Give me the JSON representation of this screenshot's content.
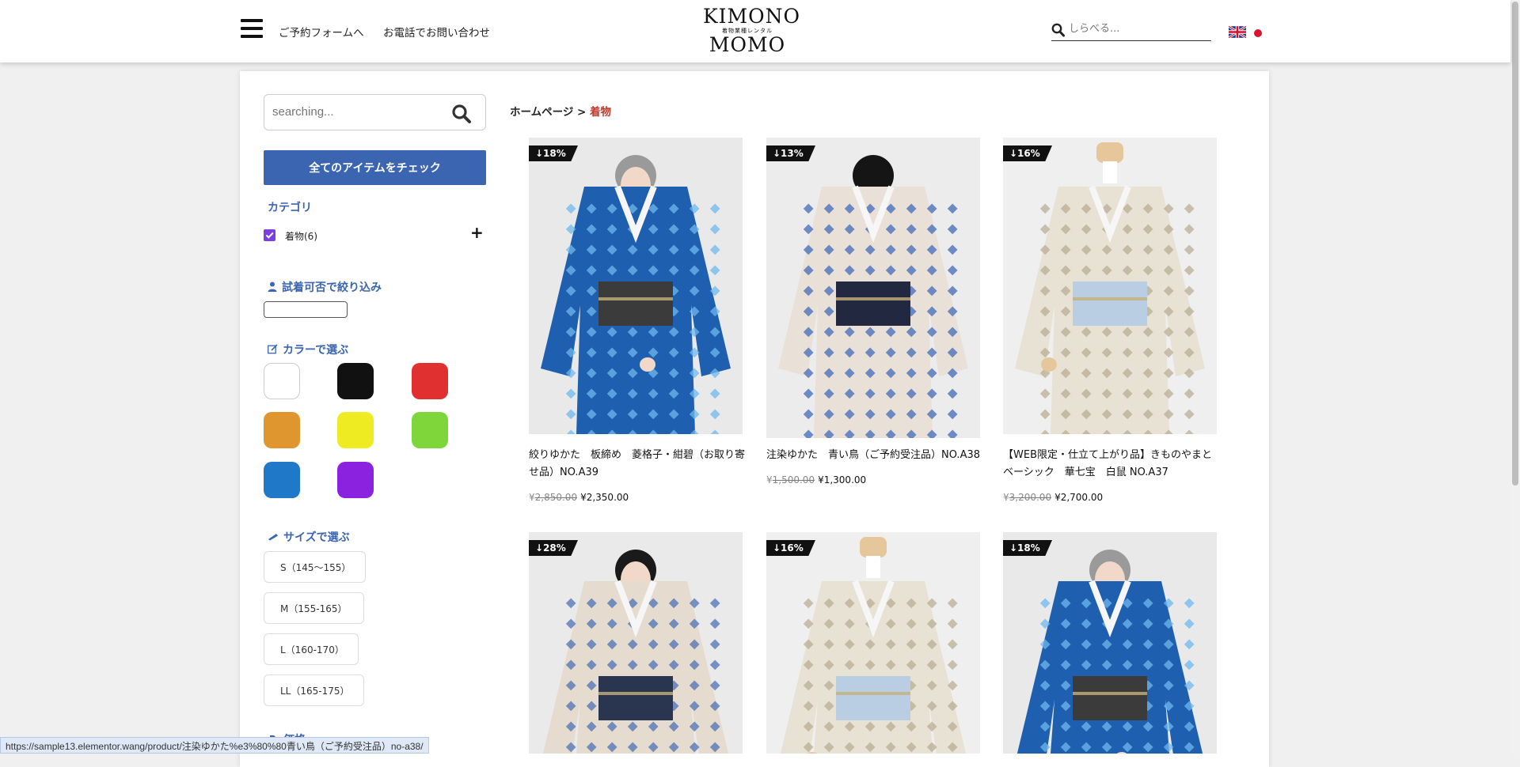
{
  "header": {
    "nav_links": [
      "ご予約フォームへ",
      "お電話でお問い合わせ"
    ],
    "logo": {
      "line1": "KIMONO",
      "line2": "着物業種レンタル",
      "line3": "MOMO"
    },
    "search_placeholder": "しらべる..."
  },
  "sidebar": {
    "search_placeholder": "searching...",
    "check_all_label": "全てのアイテムをチェック",
    "category_title": "カテゴリ",
    "category_item": "着物(6)",
    "tryon_title": "試着可否で絞り込み",
    "color_title": "カラーで選ぶ",
    "colors": [
      "#ffffff",
      "#111111",
      "#e03030",
      "#e0962e",
      "#efeb22",
      "#7ed63a",
      "#1f78c8",
      "#8a22e0"
    ],
    "size_title": "サイズで選ぶ",
    "sizes": [
      "S（145～155）",
      "M（155-165）",
      "L（160-170）",
      "LL（165-175）"
    ],
    "next_section": "価格"
  },
  "breadcrumb": {
    "home": "ホームページ",
    "separator": ">",
    "current": "着物"
  },
  "products": [
    {
      "badge": "↓18%",
      "title": "絞りゆかた　板締め　菱格子・紺碧（お取り寄せ品）NO.A39",
      "old_yen": "¥",
      "old_price": "2,850.00",
      "new_price": "¥2,350.00"
    },
    {
      "badge": "↓13%",
      "title": "注染ゆかた　青い鳥（ご予約受注品）NO.A38",
      "old_yen": "¥",
      "old_price": "1,500.00",
      "new_price": "¥1,300.00"
    },
    {
      "badge": "↓16%",
      "title": "【WEB限定・仕立て上がり品】きものやまと ベーシック　華七宝　白鼠 NO.A37",
      "old_yen": "¥",
      "old_price": "3,200.00",
      "new_price": "¥2,700.00"
    },
    {
      "badge": "↓28%"
    },
    {
      "badge": "↓16%"
    },
    {
      "badge": "↓18%"
    }
  ],
  "status_url": "https://sample13.elementor.wang/product/注染ゆかた%e3%80%80青い鳥（ご予約受注品）no-a38/"
}
